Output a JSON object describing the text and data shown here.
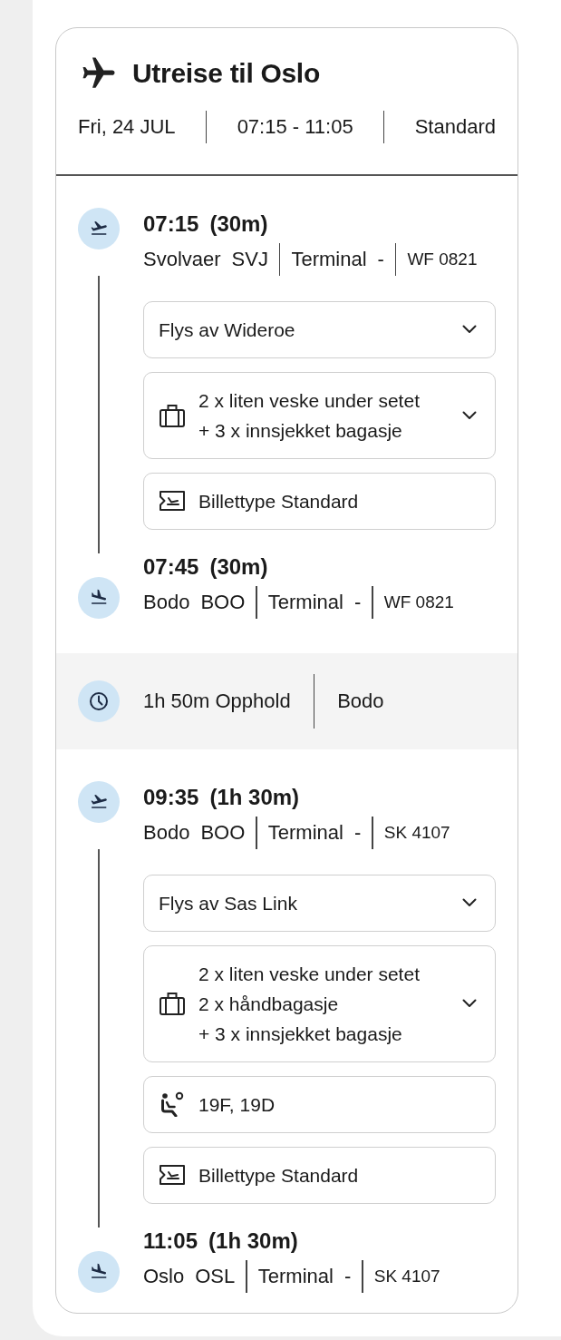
{
  "header": {
    "title": "Utreise til Oslo",
    "date": "Fri, 24 JUL",
    "time_range": "07:15 - 11:05",
    "fare": "Standard"
  },
  "segments": [
    {
      "kind": "flight",
      "departure": {
        "time": "07:15",
        "duration": "(30m)",
        "airport": "Svolvaer",
        "code": "SVJ",
        "terminal_label": "Terminal",
        "terminal": "-",
        "flight_no": "WF 0821"
      },
      "details": [
        {
          "kind": "airline",
          "lines": [
            "Flys av Wideroe"
          ],
          "expandable": true
        },
        {
          "kind": "baggage",
          "lines": [
            "2 x liten veske under setet",
            "+ 3 x innsjekket bagasje"
          ],
          "expandable": true
        },
        {
          "kind": "ticket",
          "lines": [
            "Billettype Standard"
          ],
          "expandable": false
        }
      ],
      "arrival": {
        "time": "07:45",
        "duration": "(30m)",
        "airport": "Bodo",
        "code": "BOO",
        "terminal_label": "Terminal",
        "terminal": "-",
        "flight_no": "WF 0821"
      }
    },
    {
      "kind": "layover",
      "duration": "1h 50m Opphold",
      "place": "Bodo"
    },
    {
      "kind": "flight",
      "departure": {
        "time": "09:35",
        "duration": "(1h 30m)",
        "airport": "Bodo",
        "code": "BOO",
        "terminal_label": "Terminal",
        "terminal": "-",
        "flight_no": "SK 4107"
      },
      "details": [
        {
          "kind": "airline",
          "lines": [
            "Flys av Sas Link"
          ],
          "expandable": true
        },
        {
          "kind": "baggage",
          "lines": [
            "2 x liten veske under setet",
            "2 x håndbagasje",
            "+ 3 x innsjekket bagasje"
          ],
          "expandable": true
        },
        {
          "kind": "seat",
          "lines": [
            "19F, 19D"
          ],
          "expandable": false
        },
        {
          "kind": "ticket",
          "lines": [
            "Billettype Standard"
          ],
          "expandable": false
        }
      ],
      "arrival": {
        "time": "11:05",
        "duration": "(1h 30m)",
        "airport": "Oslo",
        "code": "OSL",
        "terminal_label": "Terminal",
        "terminal": "-",
        "flight_no": "SK 4107"
      }
    }
  ]
}
